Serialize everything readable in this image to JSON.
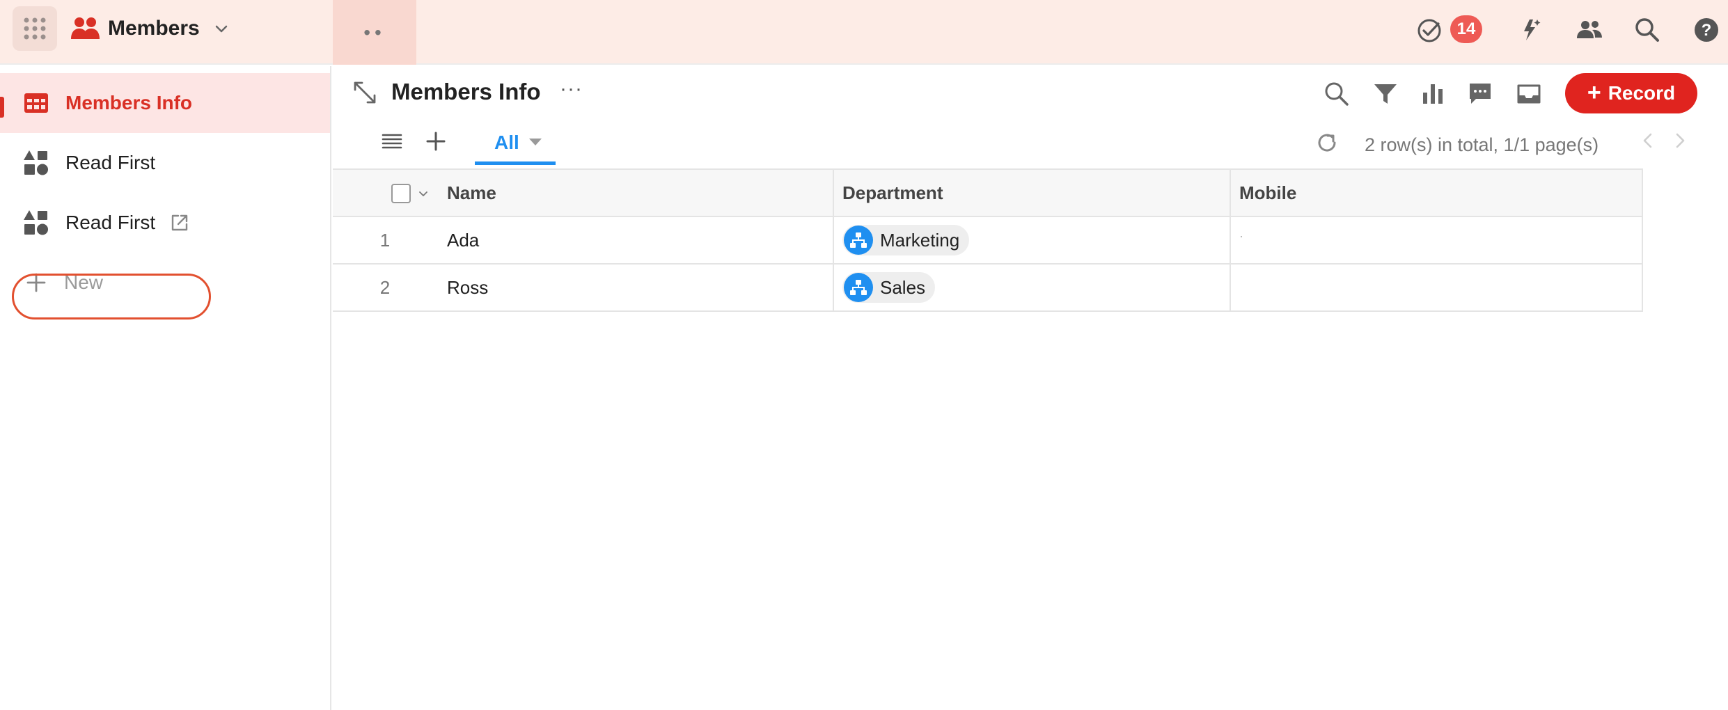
{
  "app": {
    "title": "Members",
    "todo_count": "14"
  },
  "colors": {
    "accent": "#d93025",
    "record_button": "#e0241f",
    "link_blue": "#1f8ff0",
    "topbar_bg": "#fdece6",
    "highlight_ring": "#e2502f"
  },
  "sidebar": {
    "items": [
      {
        "label": "Members Info",
        "icon": "table-icon",
        "active": true
      },
      {
        "label": "Read First",
        "icon": "shapes-icon",
        "active": false
      },
      {
        "label": "Read First",
        "icon": "shapes-icon",
        "active": false,
        "external_link_icon": true
      },
      {
        "label": "New",
        "icon": "plus-icon",
        "active": false
      }
    ]
  },
  "view": {
    "title": "Members Info",
    "record_button": "Record",
    "tab": "All",
    "pagination": "2 row(s) in total, 1/1 page(s)"
  },
  "table": {
    "columns": [
      "Name",
      "Department",
      "Mobile"
    ],
    "rows": [
      {
        "index": "1",
        "name": "Ada",
        "department": "Marketing",
        "mobile": ""
      },
      {
        "index": "2",
        "name": "Ross",
        "department": "Sales",
        "mobile": ""
      }
    ]
  }
}
